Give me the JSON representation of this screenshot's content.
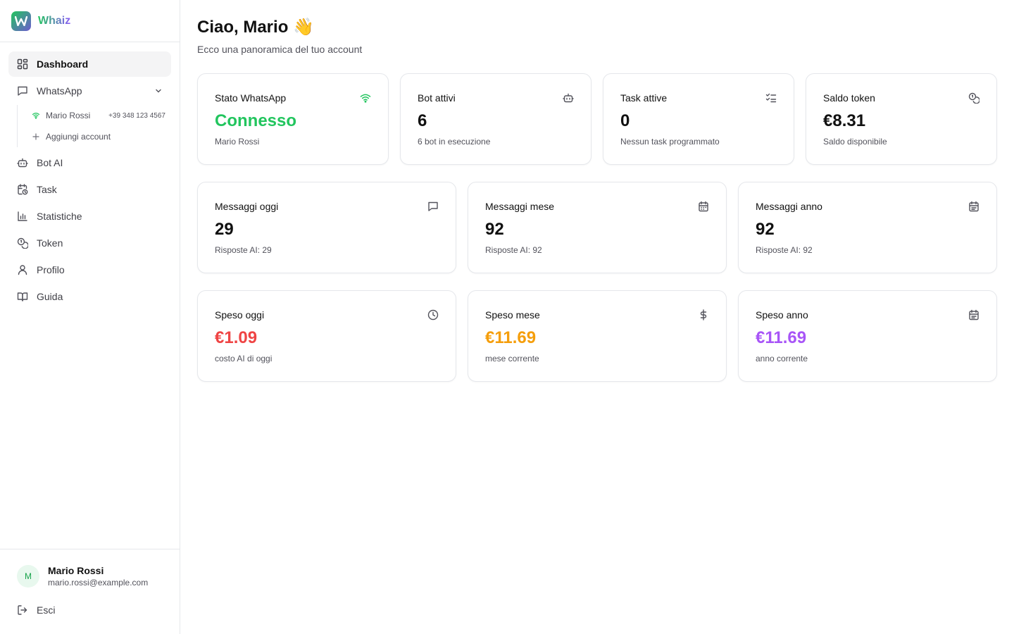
{
  "app": {
    "name": "Whaiz"
  },
  "sidebar": {
    "items": [
      {
        "label": "Dashboard",
        "icon": "layout-dashboard-icon",
        "active": true
      },
      {
        "label": "WhatsApp",
        "icon": "message-square-icon"
      },
      {
        "label": "Bot AI",
        "icon": "bot-icon"
      },
      {
        "label": "Task",
        "icon": "calendar-clock-icon"
      },
      {
        "label": "Statistiche",
        "icon": "bar-chart-icon"
      },
      {
        "label": "Token",
        "icon": "coins-icon"
      },
      {
        "label": "Profilo",
        "icon": "user-icon"
      },
      {
        "label": "Guida",
        "icon": "book-open-icon"
      }
    ],
    "whatsapp_sub": {
      "account_name": "Mario Rossi",
      "account_phone": "+39 348 123 4567",
      "add_label": "Aggiungi account"
    }
  },
  "user": {
    "initial": "M",
    "name": "Mario Rossi",
    "email": "mario.rossi@example.com",
    "logout_label": "Esci"
  },
  "header": {
    "greeting": "Ciao, Mario 👋",
    "subtitle": "Ecco una panoramica del tuo account"
  },
  "cards": {
    "row1": [
      {
        "title": "Stato WhatsApp",
        "value": "Connesso",
        "desc": "Mario Rossi",
        "icon": "wifi-icon",
        "value_color": "#22c55e"
      },
      {
        "title": "Bot attivi",
        "value": "6",
        "desc": "6 bot in esecuzione",
        "icon": "bot-icon"
      },
      {
        "title": "Task attive",
        "value": "0",
        "desc": "Nessun task programmato",
        "icon": "list-checks-icon"
      },
      {
        "title": "Saldo token",
        "value": "€8.31",
        "desc": "Saldo disponibile",
        "icon": "coins-icon"
      }
    ],
    "row2": [
      {
        "title": "Messaggi oggi",
        "value": "29",
        "desc": "Risposte AI: 29",
        "icon": "message-square-icon"
      },
      {
        "title": "Messaggi mese",
        "value": "92",
        "desc": "Risposte AI: 92",
        "icon": "calendar-icon"
      },
      {
        "title": "Messaggi anno",
        "value": "92",
        "desc": "Risposte AI: 92",
        "icon": "calendar-days-icon"
      }
    ],
    "row3": [
      {
        "title": "Speso oggi",
        "value": "€1.09",
        "desc": "costo AI di oggi",
        "icon": "clock-icon",
        "value_color": "#ef4444"
      },
      {
        "title": "Speso mese",
        "value": "€11.69",
        "desc": "mese corrente",
        "icon": "dollar-sign-icon",
        "value_color": "#f59e0b"
      },
      {
        "title": "Speso anno",
        "value": "€11.69",
        "desc": "anno corrente",
        "icon": "calendar-days-icon",
        "value_color": "#a855f7"
      }
    ]
  },
  "colors": {
    "accent_green": "#22c55e",
    "spend_today": "#ef4444",
    "spend_month": "#f59e0b",
    "spend_year": "#a855f7"
  }
}
